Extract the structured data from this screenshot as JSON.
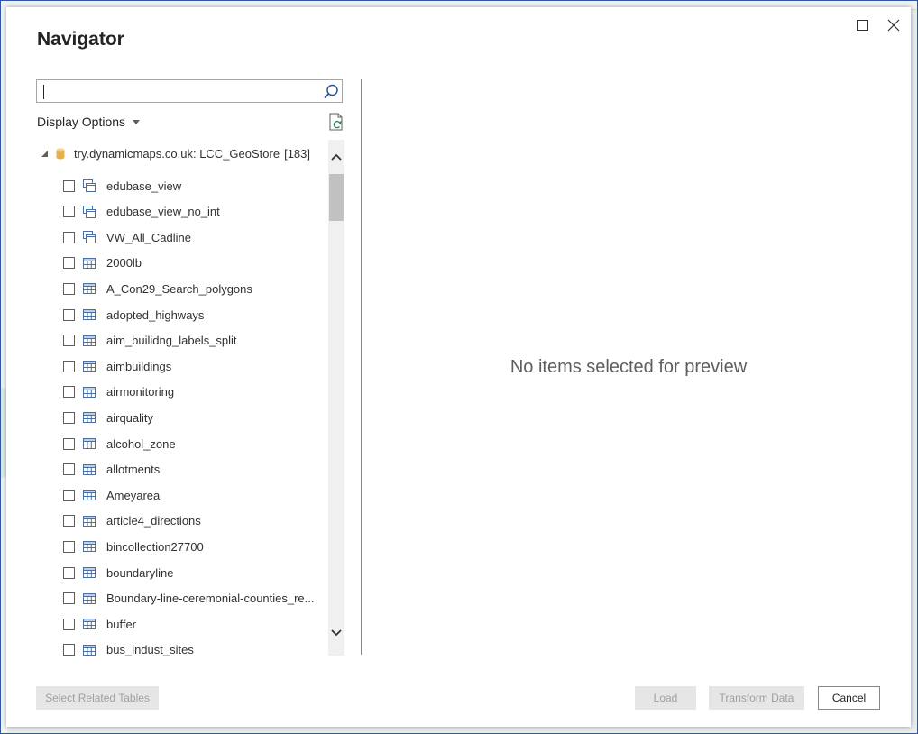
{
  "dialog": {
    "title": "Navigator"
  },
  "search": {
    "value": "",
    "placeholder": ""
  },
  "display_options": {
    "label": "Display Options"
  },
  "tree": {
    "root": {
      "label": "try.dynamicmaps.co.uk: LCC_GeoStore",
      "count": "[183]"
    },
    "items": [
      {
        "label": "edubase_view",
        "icon": "view-icon"
      },
      {
        "label": "edubase_view_no_int",
        "icon": "view-icon"
      },
      {
        "label": "VW_All_Cadline",
        "icon": "view-icon"
      },
      {
        "label": "2000lb",
        "icon": "table-icon"
      },
      {
        "label": "A_Con29_Search_polygons",
        "icon": "table-icon"
      },
      {
        "label": "adopted_highways",
        "icon": "table-icon"
      },
      {
        "label": "aim_builidng_labels_split",
        "icon": "table-icon"
      },
      {
        "label": "aimbuildings",
        "icon": "table-icon"
      },
      {
        "label": "airmonitoring",
        "icon": "table-icon"
      },
      {
        "label": "airquality",
        "icon": "table-icon"
      },
      {
        "label": "alcohol_zone",
        "icon": "table-icon"
      },
      {
        "label": "allotments",
        "icon": "table-icon"
      },
      {
        "label": "Ameyarea",
        "icon": "table-icon"
      },
      {
        "label": "article4_directions",
        "icon": "table-icon"
      },
      {
        "label": "bincollection27700",
        "icon": "table-icon"
      },
      {
        "label": "boundaryline",
        "icon": "table-icon"
      },
      {
        "label": "Boundary-line-ceremonial-counties_re...",
        "icon": "table-icon"
      },
      {
        "label": "buffer",
        "icon": "table-icon"
      },
      {
        "label": "bus_indust_sites",
        "icon": "table-icon"
      }
    ]
  },
  "preview": {
    "message": "No items selected for preview"
  },
  "buttons": {
    "select_related": "Select Related Tables",
    "load": "Load",
    "transform": "Transform Data",
    "cancel": "Cancel"
  },
  "colors": {
    "accent_border": "#2f56a6",
    "db_icon": "#e8b04a",
    "disabled_bg": "#e6e6e6",
    "disabled_text": "#a19f9d"
  }
}
